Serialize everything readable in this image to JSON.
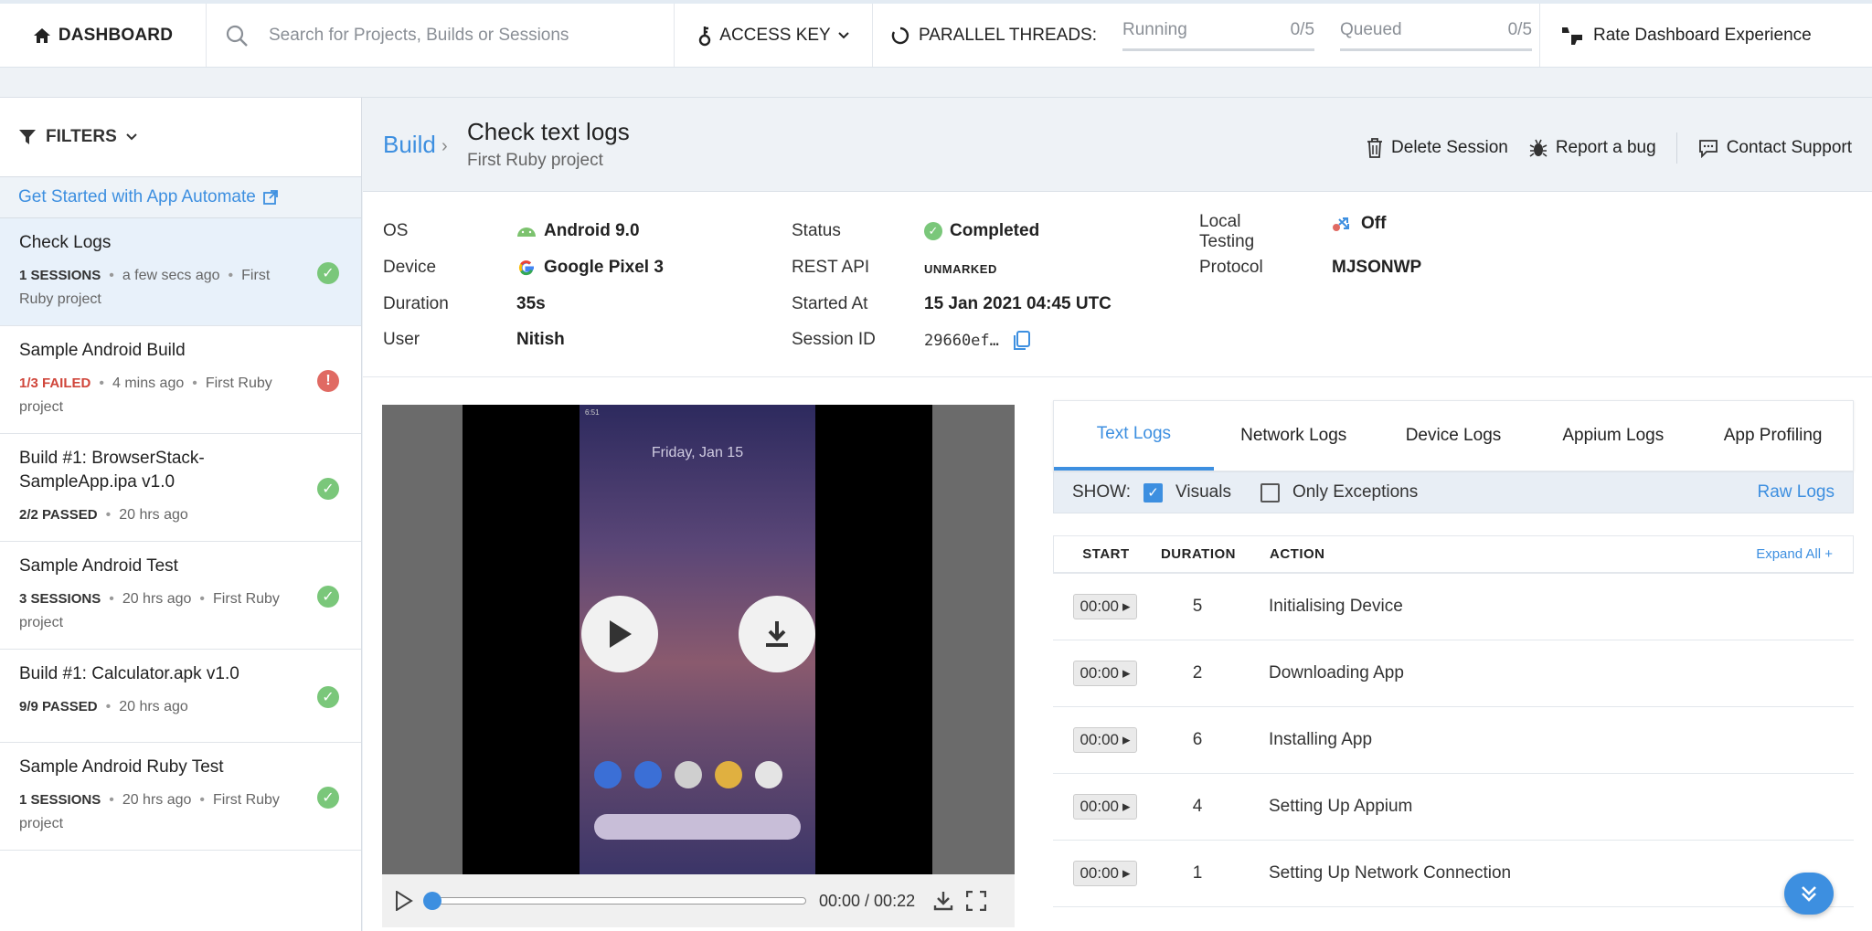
{
  "topbar": {
    "dashboard": "DASHBOARD",
    "search_placeholder": "Search for Projects, Builds or Sessions",
    "access_key": "ACCESS KEY",
    "parallel_threads": "PARALLEL THREADS:",
    "running_label": "Running",
    "running_value": "0/5",
    "queued_label": "Queued",
    "queued_value": "0/5",
    "rate": "Rate Dashboard Experience"
  },
  "sidebar": {
    "filters": "FILTERS",
    "get_started": "Get Started with App Automate",
    "builds": [
      {
        "name": "Check Logs",
        "count": "1 SESSIONS",
        "time": "a few secs ago",
        "project": "First Ruby project",
        "status": "passed"
      },
      {
        "name": "Sample Android Build",
        "count": "1/3 FAILED",
        "time": "4 mins ago",
        "project": "First Ruby project",
        "status": "failed"
      },
      {
        "name": "Build #1: BrowserStack-SampleApp.ipa v1.0",
        "count": "2/2 PASSED",
        "time": "20 hrs ago",
        "project": "",
        "status": "passed"
      },
      {
        "name": "Sample Android Test",
        "count": "3 SESSIONS",
        "time": "20 hrs ago",
        "project": "First Ruby project",
        "status": "passed"
      },
      {
        "name": "Build #1: Calculator.apk v1.0",
        "count": "9/9 PASSED",
        "time": "20 hrs ago",
        "project": "",
        "status": "passed"
      },
      {
        "name": "Sample Android Ruby Test",
        "count": "1 SESSIONS",
        "time": "20 hrs ago",
        "project": "First Ruby project",
        "status": "passed"
      }
    ]
  },
  "header": {
    "breadcrumb": "Build",
    "title": "Check text logs",
    "subtitle": "First Ruby project",
    "delete": "Delete Session",
    "report": "Report a bug",
    "support": "Contact Support"
  },
  "details": {
    "os_label": "OS",
    "os_value": "Android 9.0",
    "device_label": "Device",
    "device_value": "Google Pixel 3",
    "duration_label": "Duration",
    "duration_value": "35s",
    "user_label": "User",
    "user_value": "Nitish",
    "status_label": "Status",
    "status_value": "Completed",
    "rest_label": "REST API",
    "rest_value": "UNMARKED",
    "started_label": "Started At",
    "started_value": "15 Jan 2021 04:45 UTC",
    "session_label": "Session ID",
    "session_value": "29660ef…",
    "local_label_1": "Local",
    "local_label_2": "Testing",
    "local_value": "Off",
    "protocol_label": "Protocol",
    "protocol_value": "MJSONWP"
  },
  "video": {
    "phone_date": "Friday, Jan 15",
    "phone_time": "6:51",
    "time_display": "00:00 / 00:22",
    "progress": 0
  },
  "logs": {
    "tabs": [
      "Text Logs",
      "Network Logs",
      "Device Logs",
      "Appium Logs",
      "App Profiling"
    ],
    "show_label": "SHOW:",
    "visuals_label": "Visuals",
    "exceptions_label": "Only Exceptions",
    "raw_logs": "Raw Logs",
    "col_start": "START",
    "col_duration": "DURATION",
    "col_action": "ACTION",
    "expand_all": "Expand All +",
    "rows": [
      {
        "start": "00:00",
        "duration": "5",
        "action": "Initialising Device"
      },
      {
        "start": "00:00",
        "duration": "2",
        "action": "Downloading App"
      },
      {
        "start": "00:00",
        "duration": "6",
        "action": "Installing App"
      },
      {
        "start": "00:00",
        "duration": "4",
        "action": "Setting Up Appium"
      },
      {
        "start": "00:00",
        "duration": "1",
        "action": "Setting Up Network Connection"
      }
    ]
  },
  "colors": {
    "accent": "#3d8fe0",
    "passed": "#7ac77a",
    "failed": "#e06a63"
  }
}
